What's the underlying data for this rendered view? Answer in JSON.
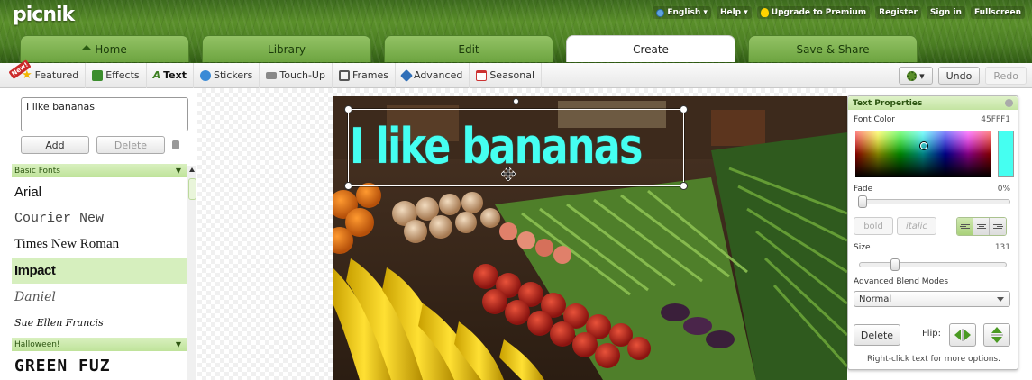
{
  "app": {
    "logo": "picnik"
  },
  "topnav": {
    "language": "English ▾",
    "help": "Help ▾",
    "upgrade": "Upgrade to Premium",
    "register": "Register",
    "signin": "Sign in",
    "fullscreen": "Fullscreen"
  },
  "maintabs": [
    {
      "label": "Home"
    },
    {
      "label": "Library"
    },
    {
      "label": "Edit"
    },
    {
      "label": "Create",
      "active": true
    },
    {
      "label": "Save & Share"
    }
  ],
  "subtools": {
    "badge": "New!",
    "featured": "Featured",
    "effects": "Effects",
    "text": "Text",
    "stickers": "Stickers",
    "touchup": "Touch-Up",
    "frames": "Frames",
    "advanced": "Advanced",
    "seasonal": "Seasonal"
  },
  "toolbar_right": {
    "settings": "▾",
    "undo": "Undo",
    "redo": "Redo"
  },
  "leftpanel": {
    "text_value": "I like bananas",
    "add_label": "Add",
    "delete_label": "Delete",
    "basic_fonts_header": "Basic Fonts",
    "fonts": [
      "Arial",
      "Courier New",
      "Times New Roman",
      "Impact",
      "Daniel",
      "Sue Ellen Francis"
    ],
    "halloween_header": "Halloween!",
    "halloween_fonts": [
      "GREEN FUZ"
    ]
  },
  "canvas": {
    "overlay_text": "I like bananas",
    "text_color": "#45FFF1"
  },
  "text_properties": {
    "title": "Text Properties",
    "font_color_label": "Font Color",
    "font_color_value": "45FFF1",
    "fade_label": "Fade",
    "fade_value": "0%",
    "fade_fraction": 0.0,
    "bold_label": "bold",
    "italic_label": "italic",
    "size_label": "Size",
    "size_value": "131",
    "advanced_blend_label": "Advanced Blend Modes",
    "blend_mode": "Normal",
    "delete_label": "Delete",
    "flip_label": "Flip:",
    "hint": "Right-click text for more options."
  },
  "colors": {
    "accent_green": "#6da440",
    "text_cyan": "#45fff1"
  }
}
